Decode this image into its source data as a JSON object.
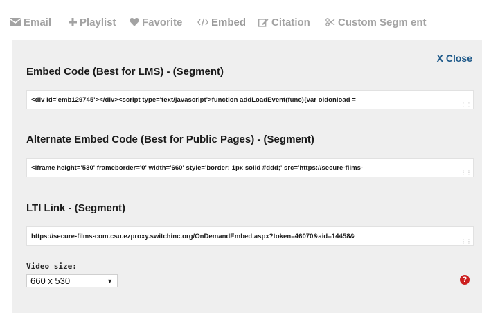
{
  "tabs": [
    {
      "label": "Email",
      "icon": "envelope-icon"
    },
    {
      "label": "Playlist",
      "icon": "plus-icon"
    },
    {
      "label": "Favorite",
      "icon": "heart-icon"
    },
    {
      "label": "Embed",
      "icon": "code-icon"
    },
    {
      "label": "Citation",
      "icon": "pencil-square-icon"
    },
    {
      "label": "Custom Segm ent",
      "icon": "scissors-icon"
    }
  ],
  "close_label": "X Close",
  "sections": [
    {
      "heading": "Embed Code (Best for LMS) - (Segment)",
      "code": "<div id='emb129745'></div><script type='text/javascript'>function addLoadEvent(func){var oldonload ="
    },
    {
      "heading": "Alternate Embed Code (Best for Public Pages) - (Segment)",
      "code": "<iframe height='530' frameborder='0' width='660' style='border: 1px solid #ddd;' src='https://secure-films-"
    },
    {
      "heading": "LTI Link - (Segment)",
      "code": "https://secure-films-com.csu.ezproxy.switchinc.org/OnDemandEmbed.aspx?token=46070&aid=14458&"
    }
  ],
  "video_size": {
    "label": "Video size:",
    "selected": "660 x 530"
  },
  "help_label": "?",
  "colors": {
    "tab_text": "#a3a3a3",
    "panel_bg": "#efefef",
    "close_link": "#1f5a8a",
    "help_badge": "#cc1f1f"
  }
}
